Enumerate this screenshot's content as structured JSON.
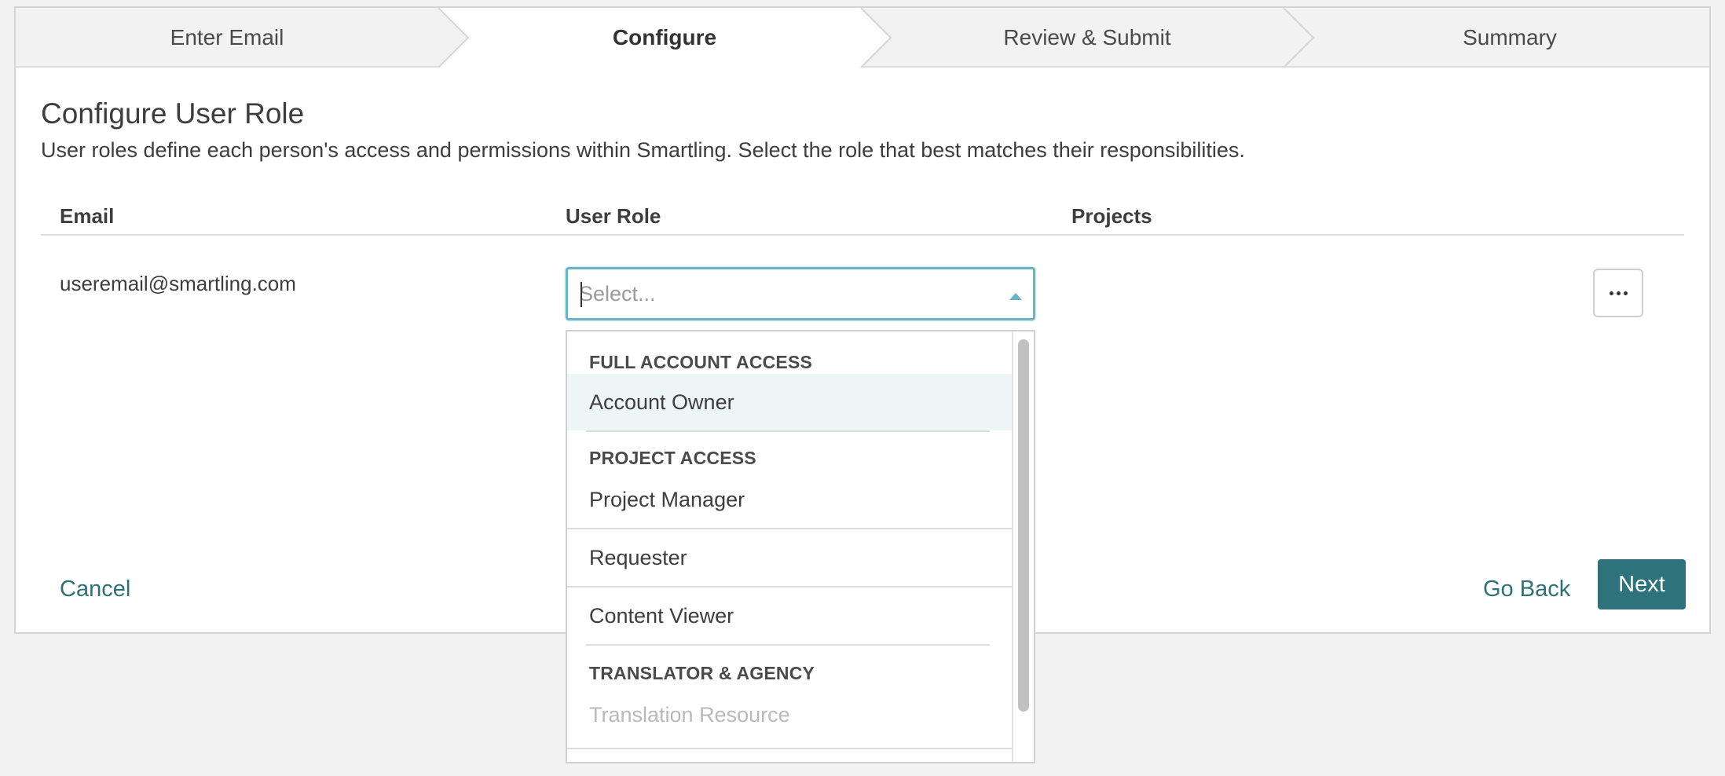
{
  "stepper": {
    "steps": [
      {
        "label": "Enter Email"
      },
      {
        "label": "Configure"
      },
      {
        "label": "Review & Submit"
      },
      {
        "label": "Summary"
      }
    ],
    "active_index": 1
  },
  "page": {
    "title": "Configure User Role",
    "description": "User roles define each person's access and permissions within Smartling. Select the role that best matches their responsibilities."
  },
  "table": {
    "columns": [
      "Email",
      "User Role",
      "Projects"
    ],
    "row": {
      "email": "useremail@smartling.com",
      "role_placeholder": "Select..."
    }
  },
  "role_menu": {
    "groups": [
      {
        "heading": "FULL ACCOUNT ACCESS",
        "options": [
          "Account Owner"
        ]
      },
      {
        "heading": "PROJECT ACCESS",
        "options": [
          "Project Manager",
          "Requester",
          "Content Viewer"
        ]
      },
      {
        "heading": "TRANSLATOR & AGENCY",
        "options": [
          "Translation Resource"
        ]
      }
    ],
    "hovered_option": "Account Owner",
    "disabled_option": "Translation Resource"
  },
  "footer": {
    "cancel_label": "Cancel",
    "go_back_label": "Go Back",
    "next_label": "Next"
  },
  "colors": {
    "accent": "#2e727b",
    "focus_border": "#6bb3c4",
    "hover_bg": "#eef5f7"
  },
  "icons": {
    "select_caret": "caret-up-icon",
    "more_actions": "ellipsis-icon"
  }
}
